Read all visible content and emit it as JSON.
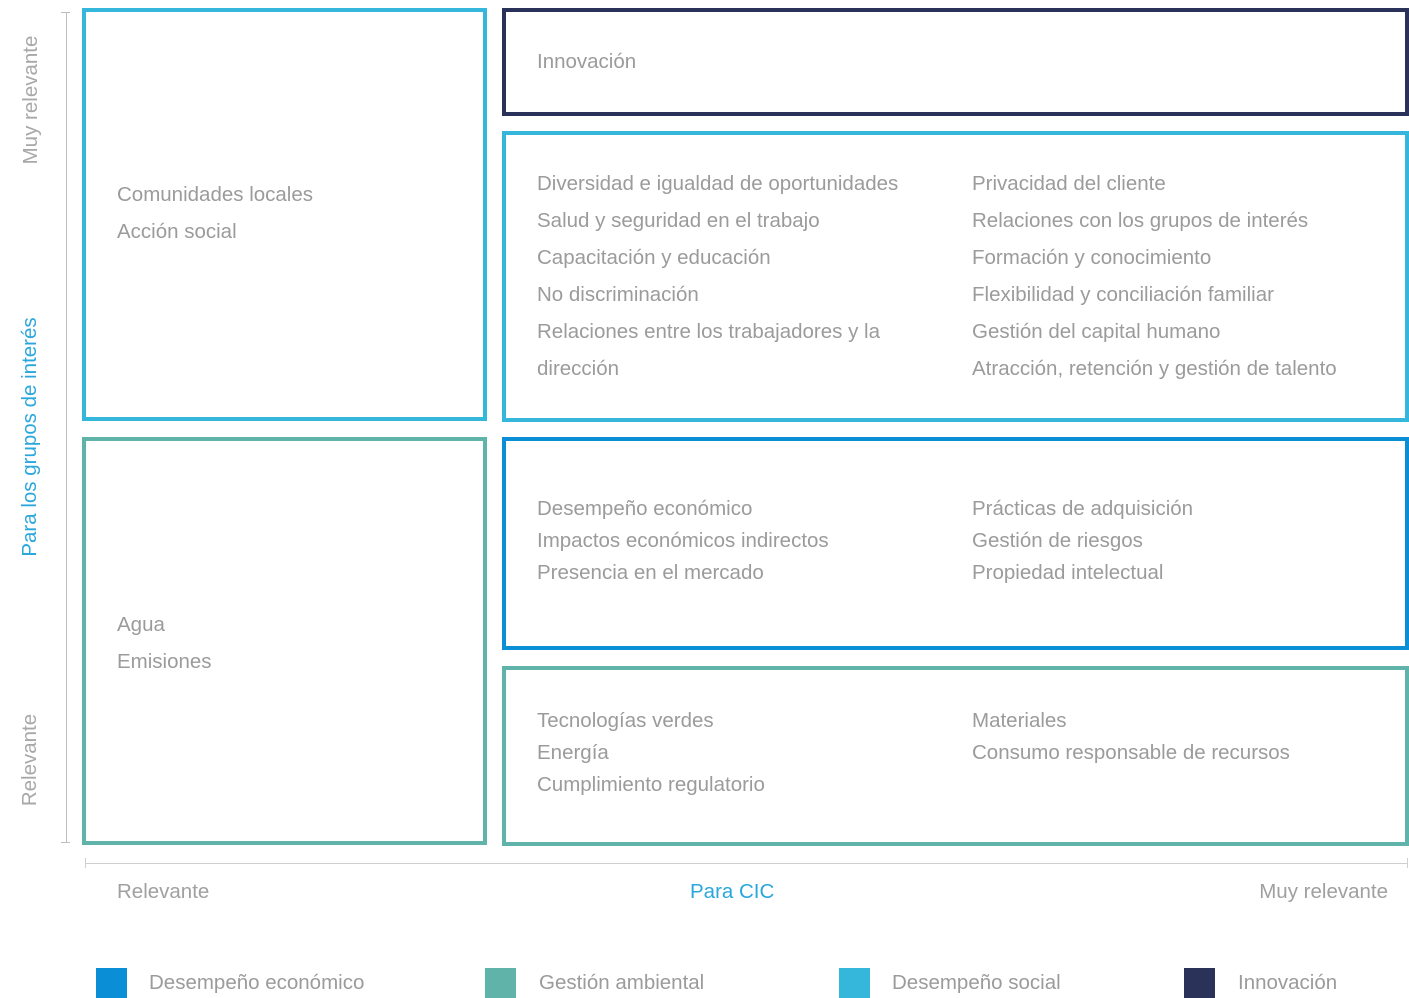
{
  "colors": {
    "economico": "#0a8fd6",
    "ambiental": "#5fb3a8",
    "social": "#35b6db",
    "innovacion": "#2a3259",
    "axis_label_accent": "#2aa7dc",
    "text_gray": "#9b9b9b"
  },
  "axes": {
    "y_title": "Para los grupos de interés",
    "y_high": "Muy relevante",
    "y_low": "Relevante",
    "x_title": "Para CIC",
    "x_low": "Relevante",
    "x_high": "Muy relevante"
  },
  "boxes": {
    "social_left": {
      "items": [
        "Comunidades locales",
        "Acción social"
      ]
    },
    "ambiental_left": {
      "items": [
        "Agua",
        "Emisiones"
      ]
    },
    "innovacion": {
      "items": [
        "Innovación"
      ]
    },
    "social_right": {
      "col1": [
        "Diversidad e igualdad de oportunidades",
        "Salud y seguridad en el trabajo",
        "Capacitación y educación",
        "No discriminación",
        "Relaciones entre los trabajadores y la",
        "dirección"
      ],
      "col2": [
        "Privacidad del cliente",
        "Relaciones con los grupos de interés",
        "Formación y conocimiento",
        "Flexibilidad y conciliación familiar",
        "Gestión del capital humano",
        "Atracción, retención y gestión de talento"
      ]
    },
    "economico_right": {
      "col1": [
        "Desempeño económico",
        "Impactos económicos indirectos",
        "Presencia en el mercado"
      ],
      "col2": [
        "Prácticas de adquisición",
        "Gestión de riesgos",
        "Propiedad intelectual"
      ]
    },
    "ambiental_right": {
      "col1": [
        "Tecnologías verdes",
        "Energía",
        "Cumplimiento regulatorio"
      ],
      "col2": [
        "Materiales",
        "Consumo responsable de recursos"
      ]
    }
  },
  "legend": [
    {
      "label": "Desempeño económico",
      "color": "#0a8fd6"
    },
    {
      "label": "Gestión ambiental",
      "color": "#5fb3a8"
    },
    {
      "label": "Desempeño social",
      "color": "#35b6db"
    },
    {
      "label": "Innovación",
      "color": "#2a3259"
    }
  ]
}
